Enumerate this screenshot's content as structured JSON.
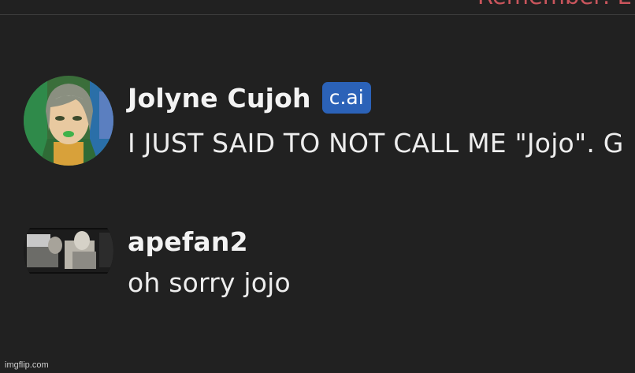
{
  "banner": {
    "text": "Remember: Ev"
  },
  "messages": [
    {
      "author": "Jolyne Cujoh",
      "badge": "c.ai",
      "text": "I JUST SAID TO NOT CALL ME \"Jojo\". G",
      "avatar_icon": "jolyne-avatar-icon"
    },
    {
      "author": "apefan2",
      "text": "oh sorry jojo",
      "avatar_icon": "user-avatar-icon"
    }
  ],
  "colors": {
    "background": "#212121",
    "badge": "#2b62b8",
    "banner_text": "#c9555c"
  },
  "watermark": "imgflip.com"
}
